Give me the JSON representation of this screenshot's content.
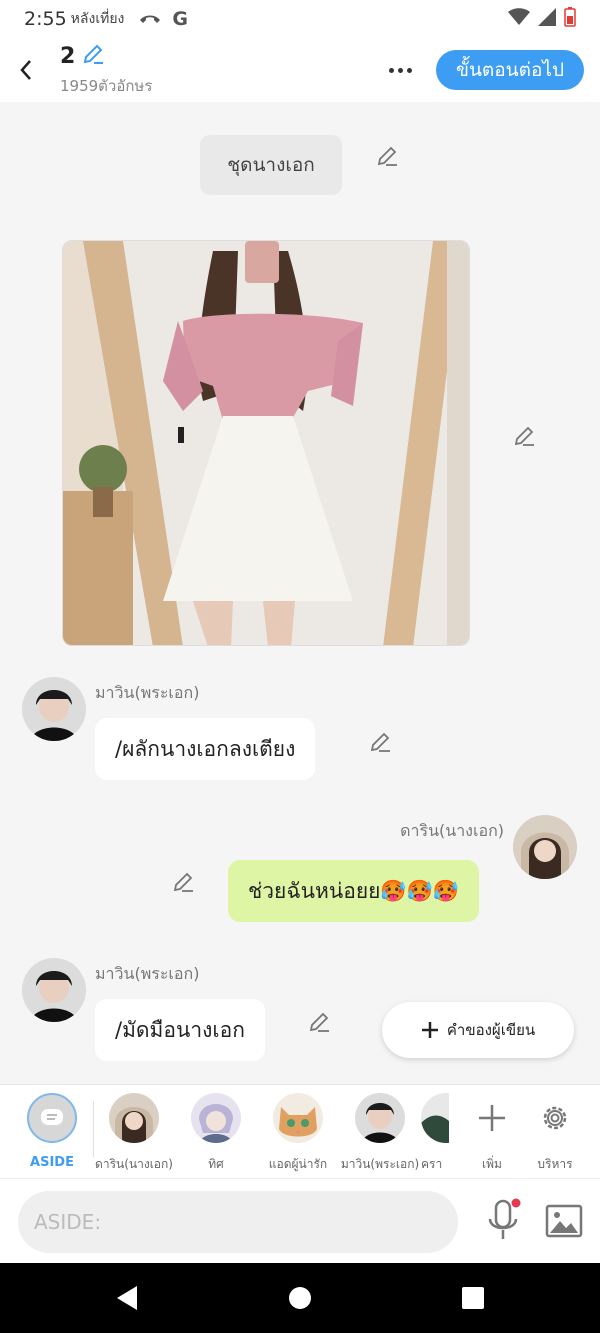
{
  "status_bar": {
    "time": "2:55",
    "period": "หลังเที่ยง",
    "google_letter": "G"
  },
  "header": {
    "title": "2",
    "subtitle": "1959ตัวอักษร",
    "next_label": "ขั้นตอนต่อไป"
  },
  "chat": {
    "narration": "ชุดนางเอก",
    "messages": [
      {
        "sender": "มาวิน(พระเอก)",
        "text": "/ผลักนางเอกลงเตียง",
        "side": "left"
      },
      {
        "sender": "ดาริน(นางเอก)",
        "text": "ช่วยฉันหน่อยย🥵🥵🥵",
        "side": "right"
      },
      {
        "sender": "มาวิน(พระเอก)",
        "text": "/มัดมือนางเอก",
        "side": "left"
      }
    ],
    "author_note_label": "คำของผู้เขียน"
  },
  "characters": {
    "aside_label": "ASIDE",
    "items": [
      {
        "label": "ดาริน(นางเอก)"
      },
      {
        "label": "ทิศ"
      },
      {
        "label": "แอดผู้น่ารัก"
      },
      {
        "label": "มาวิน(พระเอก)"
      },
      {
        "label": "ครา"
      }
    ],
    "add_label": "เพิ่ม",
    "manage_label": "บริหาร"
  },
  "input": {
    "placeholder": "ASIDE:"
  },
  "colors": {
    "accent": "#3d9df2",
    "bubble_right": "#dff5a6",
    "background": "#f5f5f5"
  }
}
